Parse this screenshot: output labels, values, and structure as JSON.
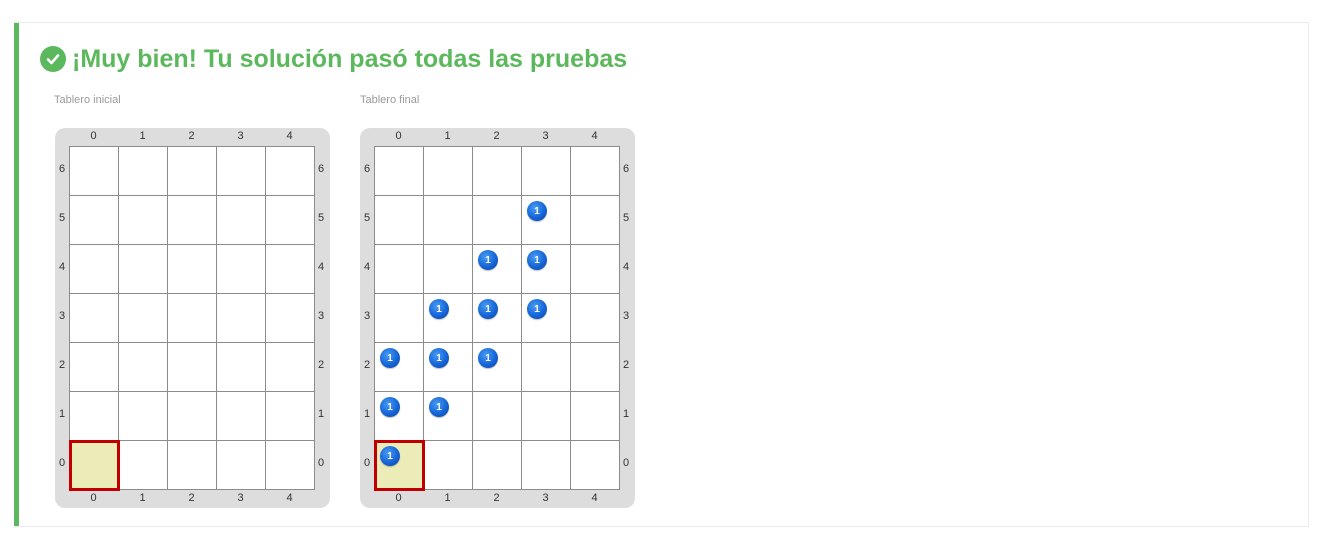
{
  "result": {
    "message": "¡Muy bien! Tu solución pasó todas las pruebas",
    "color": "#5cb85c"
  },
  "initial_board": {
    "label": "Tablero inicial",
    "columns": [
      "0",
      "1",
      "2",
      "3",
      "4"
    ],
    "rows": [
      "6",
      "5",
      "4",
      "3",
      "2",
      "1",
      "0"
    ],
    "head": {
      "x": 0,
      "y": 0
    },
    "stones": []
  },
  "final_board": {
    "label": "Tablero final",
    "columns": [
      "0",
      "1",
      "2",
      "3",
      "4"
    ],
    "rows": [
      "6",
      "5",
      "4",
      "3",
      "2",
      "1",
      "0"
    ],
    "head": {
      "x": 0,
      "y": 0
    },
    "stone_color": "blue",
    "stones": [
      {
        "x": 3,
        "y": 5,
        "count": "1"
      },
      {
        "x": 2,
        "y": 4,
        "count": "1"
      },
      {
        "x": 3,
        "y": 4,
        "count": "1"
      },
      {
        "x": 1,
        "y": 3,
        "count": "1"
      },
      {
        "x": 2,
        "y": 3,
        "count": "1"
      },
      {
        "x": 3,
        "y": 3,
        "count": "1"
      },
      {
        "x": 0,
        "y": 2,
        "count": "1"
      },
      {
        "x": 1,
        "y": 2,
        "count": "1"
      },
      {
        "x": 2,
        "y": 2,
        "count": "1"
      },
      {
        "x": 0,
        "y": 1,
        "count": "1"
      },
      {
        "x": 1,
        "y": 1,
        "count": "1"
      },
      {
        "x": 0,
        "y": 0,
        "count": "1"
      }
    ]
  }
}
